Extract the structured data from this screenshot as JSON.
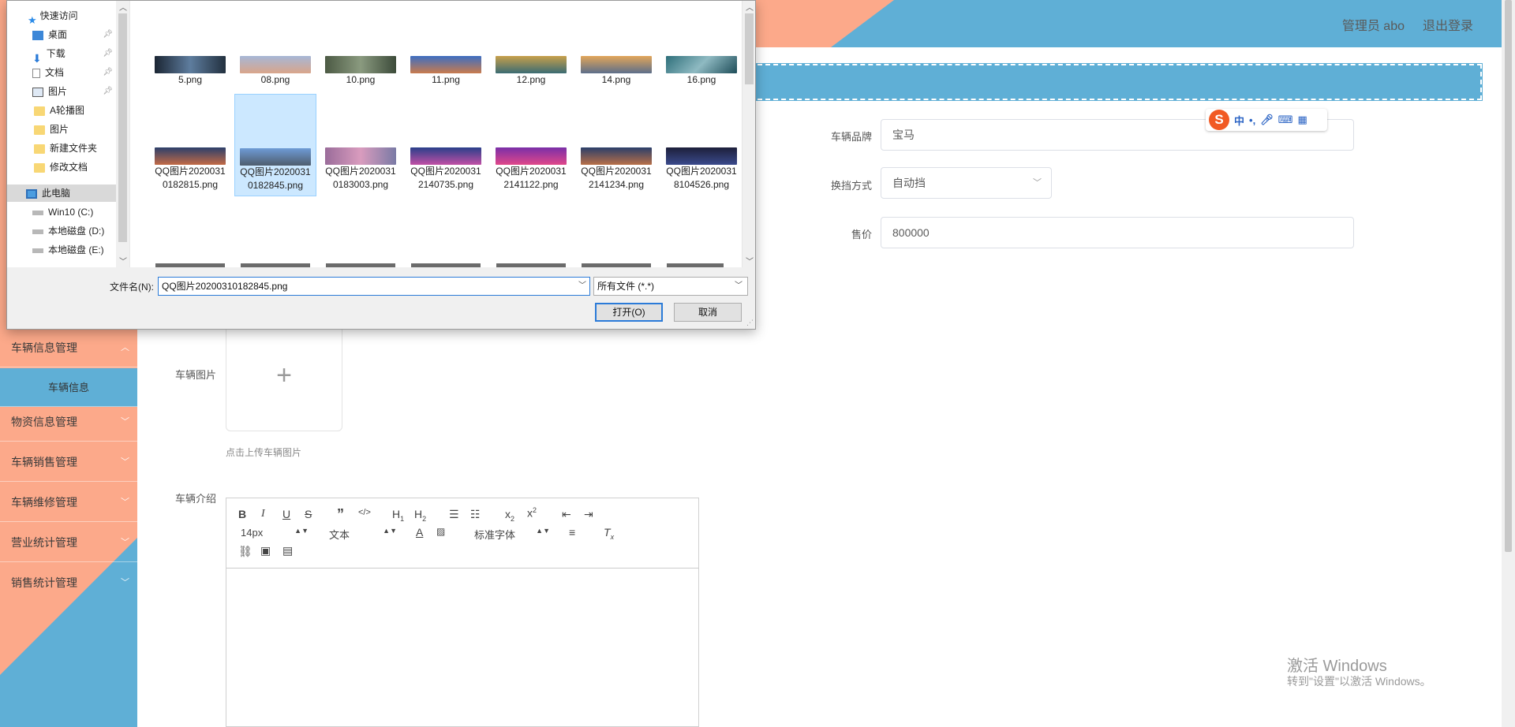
{
  "header": {
    "user": "管理员 abo",
    "logout": "退出登录"
  },
  "sidebar": {
    "items": [
      {
        "label": "车辆信息管理",
        "expanded": true
      },
      {
        "label": "车辆信息",
        "sub": true
      },
      {
        "label": "物资信息管理"
      },
      {
        "label": "车辆销售管理"
      },
      {
        "label": "车辆维修管理"
      },
      {
        "label": "营业统计管理"
      },
      {
        "label": "销售统计管理"
      }
    ]
  },
  "form": {
    "brand_label": "车辆品牌",
    "brand_value": "宝马",
    "gear_label": "换挡方式",
    "gear_value": "自动挡",
    "price_label": "售价",
    "price_value": "800000",
    "image_label": "车辆图片",
    "upload_plus": "+",
    "upload_hint": "点击上传车辆图片",
    "intro_label": "车辆介绍"
  },
  "editor": {
    "font_size": "14px",
    "paragraph": "文本",
    "font_family": "标准字体"
  },
  "ime": {
    "logo": "S",
    "mode": "中"
  },
  "watermark": {
    "title": "激活 Windows",
    "subtitle": "转到\"设置\"以激活 Windows。"
  },
  "dialog": {
    "nav": [
      {
        "label": "快速访问",
        "icon": "star-icon"
      },
      {
        "label": "桌面",
        "icon": "desktop-icon",
        "pinned": true
      },
      {
        "label": "下载",
        "icon": "download-icon",
        "pinned": true
      },
      {
        "label": "文档",
        "icon": "document-icon",
        "pinned": true
      },
      {
        "label": "图片",
        "icon": "picture-icon",
        "pinned": true
      },
      {
        "label": "A轮播图",
        "icon": "folder-icon"
      },
      {
        "label": "图片",
        "icon": "folder-icon"
      },
      {
        "label": "新建文件夹",
        "icon": "folder-icon"
      },
      {
        "label": "修改文档",
        "icon": "folder-icon"
      },
      {
        "label": "此电脑",
        "icon": "computer-icon",
        "selected": true
      },
      {
        "label": "Win10 (C:)",
        "icon": "drive-icon"
      },
      {
        "label": "本地磁盘 (D:)",
        "icon": "drive-icon"
      },
      {
        "label": "本地磁盘 (E:)",
        "icon": "drive-icon"
      }
    ],
    "files_row1": [
      {
        "name": "5.png"
      },
      {
        "name": "08.png"
      },
      {
        "name": "10.png"
      },
      {
        "name": "11.png"
      },
      {
        "name": "12.png"
      },
      {
        "name": "14.png"
      },
      {
        "name": "16.png"
      }
    ],
    "files_row2": [
      {
        "name": "QQ图片20200310182815.png"
      },
      {
        "name": "QQ图片20200310182845.png",
        "selected": true
      },
      {
        "name": "QQ图片20200310183003.png"
      },
      {
        "name": "QQ图片20200312140735.png"
      },
      {
        "name": "QQ图片20200312141122.png"
      },
      {
        "name": "QQ图片20200312141234.png"
      },
      {
        "name": "QQ图片20200318104526.png"
      }
    ],
    "filename_label": "文件名(N):",
    "filename_value": "QQ图片20200310182845.png",
    "filetype_value": "所有文件 (*.*)",
    "open_button": "打开(O)",
    "cancel_button": "取消"
  },
  "colors": {
    "accent_blue": "#5fafd6",
    "accent_salmon": "#fca98a"
  }
}
